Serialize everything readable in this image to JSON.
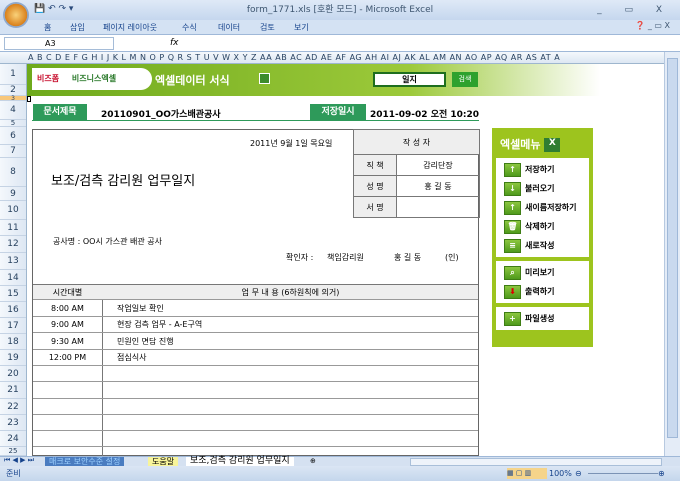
{
  "window": {
    "title": "form_1771.xls  [호환 모드] - Microsoft Excel",
    "controls": [
      "_",
      "▭",
      "X"
    ]
  },
  "ribbon": {
    "tabs": [
      "홈",
      "삽입",
      "페이지 레이아웃",
      "수식",
      "데이터",
      "검토",
      "보기"
    ]
  },
  "formula_bar": {
    "name_box": "A3",
    "fx": "fx",
    "value": ""
  },
  "columns": "A B C D E F G H I J K L M N O P Q R S T U V W X Y Z AA AB AC AD AE AF AG AH AI AJ AK AL AM AN AO AP AQ AR AS AT A",
  "rows": [
    "1",
    "2",
    "3",
    "4",
    "5",
    "6",
    "7",
    "8",
    "9",
    "10",
    "11",
    "12",
    "13",
    "14",
    "15",
    "16",
    "17",
    "18",
    "19",
    "20",
    "21",
    "22",
    "23",
    "24",
    "25"
  ],
  "banner": {
    "logo1": "비즈폼",
    "logo2": "비즈니스엑셀",
    "title": "엑셀데이터 서식",
    "search_value": "일지",
    "search_button": "검색"
  },
  "doc_info": {
    "title_label": "문서제목",
    "title_value": "20110901_OO가스배관공사",
    "saved_label": "저장일시",
    "saved_value": "2011-09-02  오전 10:20"
  },
  "form": {
    "date": "2011년 9월 1일 목요일",
    "title": "보조/검측 감리원 업무일지",
    "author_header": "작 성 자",
    "author": [
      {
        "label": "직  책",
        "value": "감리단장"
      },
      {
        "label": "성  명",
        "value": "홍 길 동"
      },
      {
        "label": "서  명",
        "value": ""
      }
    ],
    "project": "공사명 :  OO시 가스관 배관 공사",
    "confirm_label": "확인자 :",
    "confirm_role": "책임감리원",
    "confirm_name": "홍 길 동",
    "confirm_seal": "(인)",
    "table_headers": [
      "시간대별",
      "업 무 내 용 (6하원칙에 의거)"
    ],
    "entries": [
      {
        "time": "8:00 AM",
        "task": "작업일보 확인"
      },
      {
        "time": "9:00 AM",
        "task": "현장 검측 업무 - A-E구역"
      },
      {
        "time": "9:30 AM",
        "task": "민원인 면담 진행"
      },
      {
        "time": "12:00 PM",
        "task": "점심식사"
      },
      {
        "time": "",
        "task": ""
      },
      {
        "time": "",
        "task": ""
      },
      {
        "time": "",
        "task": ""
      },
      {
        "time": "",
        "task": ""
      },
      {
        "time": "",
        "task": ""
      }
    ]
  },
  "menu": {
    "title": "엑셀메뉴",
    "groups": [
      [
        "저장하기",
        "불러오기",
        "새이름저장하기",
        "삭제하기",
        "새로작성"
      ],
      [
        "미리보기",
        "출력하기"
      ],
      [
        "파일생성"
      ]
    ]
  },
  "sheet_tabs": [
    "매크로 보안수준 설정",
    "도움말",
    "보조,검측 감리원 업무일지"
  ],
  "status": {
    "ready": "준비",
    "zoom": "100%"
  }
}
